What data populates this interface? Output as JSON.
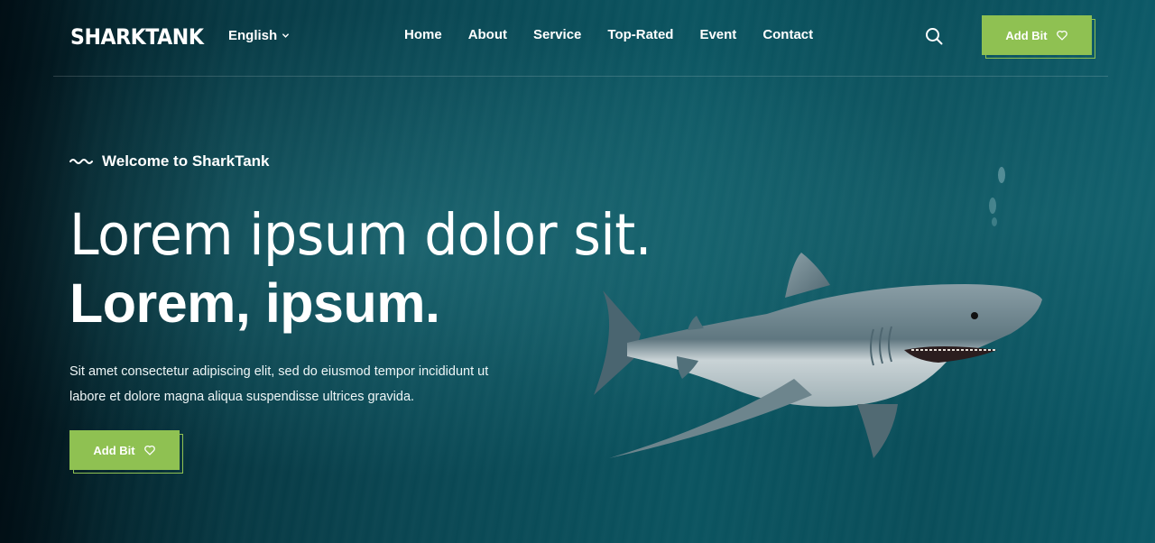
{
  "header": {
    "logo": "SHARKTANK",
    "language": "English",
    "nav": [
      "Home",
      "About",
      "Service",
      "Top-Rated",
      "Event",
      "Contact"
    ],
    "cta_label": "Add Bit"
  },
  "hero": {
    "eyebrow": "Welcome to SharkTank",
    "title_light": "Lorem ipsum dolor sit.",
    "title_bold": "Lorem, ipsum.",
    "description": "Sit amet consectetur adipiscing elit, sed do eiusmod tempor incididunt ut labore et dolore magna aliqua suspendisse ultrices gravida.",
    "cta_label": "Add Bit"
  },
  "icons": {
    "search": "search-icon",
    "language_dropdown": "chevron-down-icon",
    "cta": "heart-icon",
    "eyebrow": "wave-icon",
    "hero_image": "shark-image"
  },
  "colors": {
    "accent": "#8fc152",
    "background": "#0b4e5a",
    "text": "#ffffff"
  }
}
